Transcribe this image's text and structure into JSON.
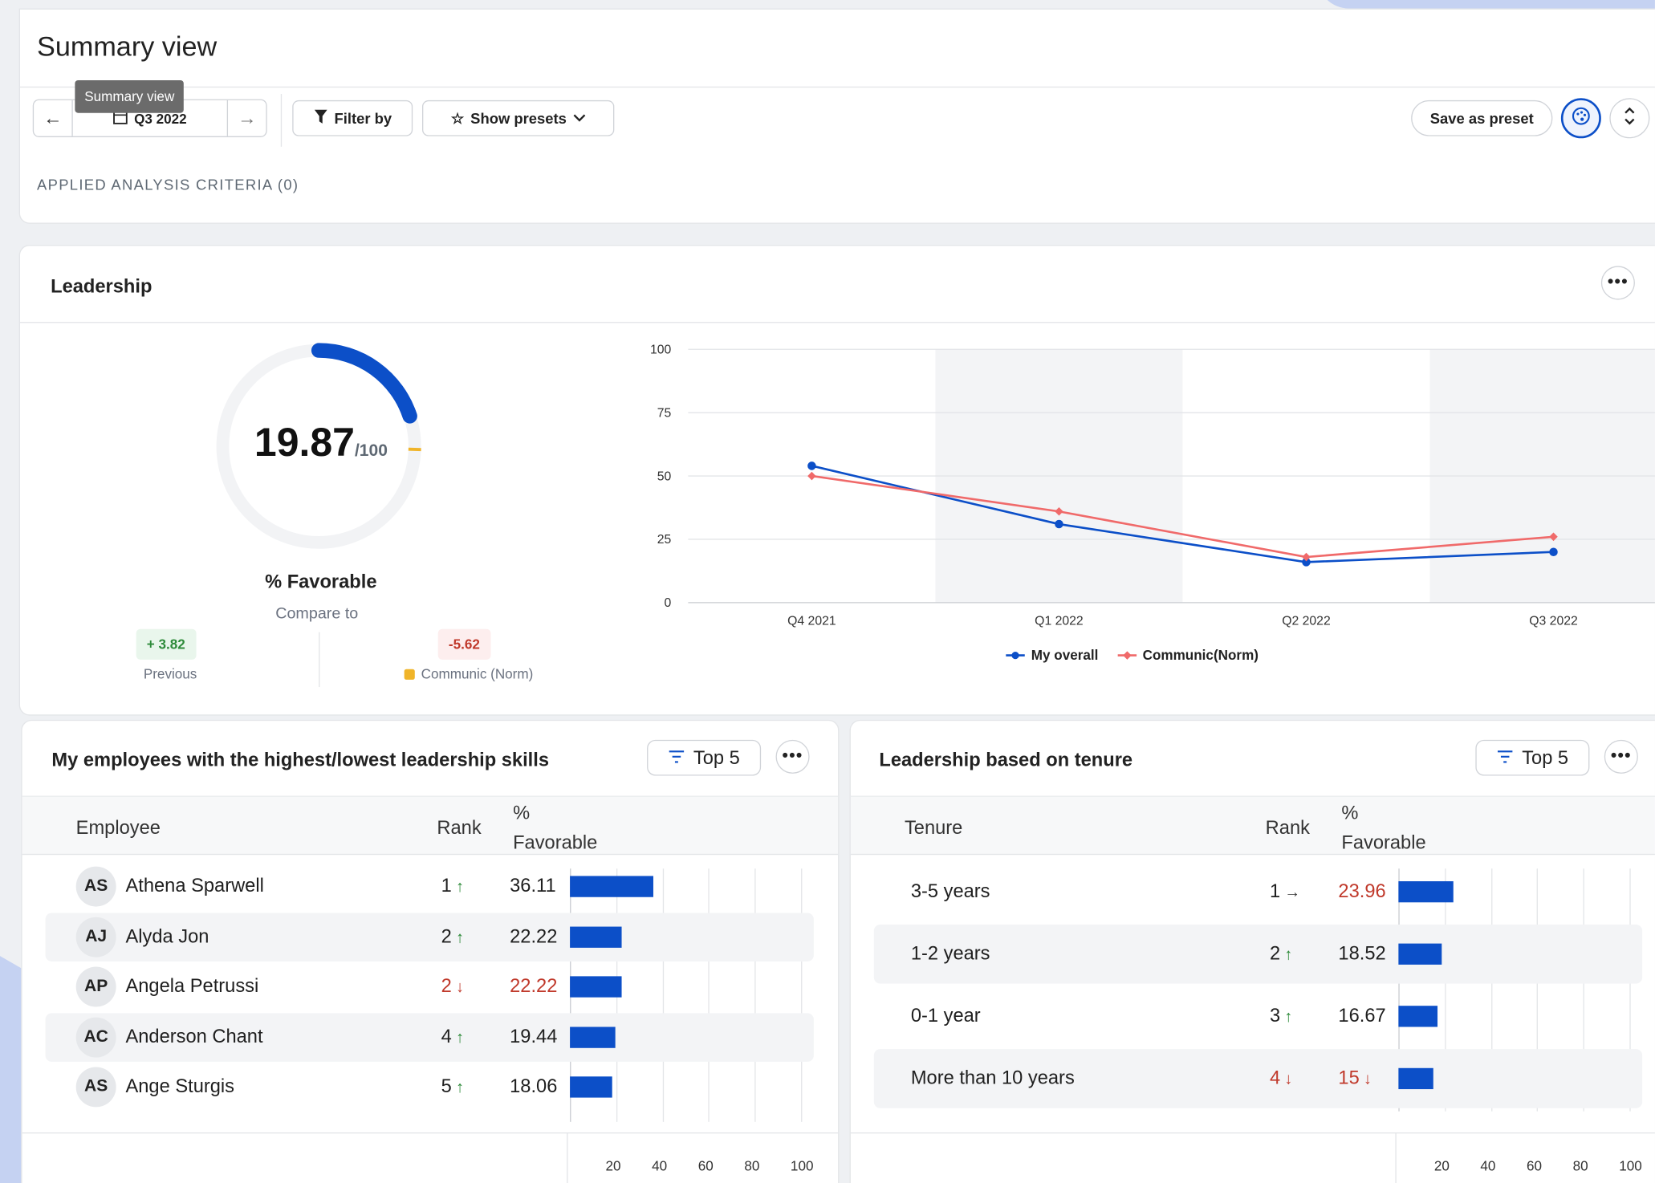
{
  "header": {
    "title": "Summary view",
    "tooltip": "Summary view",
    "date_nav": {
      "period": "Q3 2022"
    },
    "filter_label": "Filter by",
    "presets_label": "Show presets",
    "save_preset_label": "Save as preset",
    "criteria_label": "APPLIED ANALYSIS CRITERIA (0)"
  },
  "leadership": {
    "title": "Leadership",
    "score": "19.87",
    "score_denominator": "/100",
    "score_fraction": 0.1987,
    "norm_fraction": 0.2549,
    "favorable_label": "% Favorable",
    "compare_label": "Compare to",
    "previous_delta": "+ 3.82",
    "previous_label": "Previous",
    "norm_delta": "-5.62",
    "norm_label": "Communic (Norm)",
    "colors": {
      "accent": "#0c4fc8",
      "norm": "#f0b429",
      "positive": "#2e8b3a",
      "negative": "#c0392b"
    }
  },
  "chart_data": {
    "type": "line",
    "categories": [
      "Q4 2021",
      "Q1 2022",
      "Q2 2022",
      "Q3 2022"
    ],
    "ylim": [
      0,
      100
    ],
    "yticks": [
      0,
      25,
      50,
      75,
      100
    ],
    "legend_position": "bottom",
    "grid": true,
    "series": [
      {
        "name": "My overall",
        "values": [
          54,
          31,
          16,
          20
        ],
        "color": "#0c4fc8",
        "marker": "circle"
      },
      {
        "name": "Communic(Norm)",
        "values": [
          50,
          36,
          18,
          26
        ],
        "color": "#f06a6a",
        "marker": "diamond"
      }
    ]
  },
  "employees": {
    "title": "My employees with the highest/lowest leadership skills",
    "filter_label": "Top 5",
    "columns": {
      "name": "Employee",
      "rank": "Rank",
      "fav_line1": "%",
      "fav_line2": "Favorable"
    },
    "axis_ticks": [
      "20",
      "40",
      "60",
      "80",
      "100"
    ],
    "rows": [
      {
        "initials": "AS",
        "name": "Athena Sparwell",
        "rank": "1",
        "trend": "up",
        "value": "36.11",
        "value_num": 36.11,
        "value_red": false
      },
      {
        "initials": "AJ",
        "name": "Alyda Jon",
        "rank": "2",
        "trend": "up",
        "value": "22.22",
        "value_num": 22.22,
        "value_red": false
      },
      {
        "initials": "AP",
        "name": "Angela Petrussi",
        "rank": "2",
        "trend": "down",
        "value": "22.22",
        "value_num": 22.22,
        "value_red": true
      },
      {
        "initials": "AC",
        "name": "Anderson Chant",
        "rank": "4",
        "trend": "up",
        "value": "19.44",
        "value_num": 19.44,
        "value_red": false
      },
      {
        "initials": "AS",
        "name": "Ange Sturgis",
        "rank": "5",
        "trend": "up",
        "value": "18.06",
        "value_num": 18.06,
        "value_red": false
      }
    ]
  },
  "tenure": {
    "title": "Leadership based on tenure",
    "filter_label": "Top 5",
    "columns": {
      "name": "Tenure",
      "rank": "Rank",
      "fav_line1": "%",
      "fav_line2": "Favorable"
    },
    "axis_ticks": [
      "20",
      "40",
      "60",
      "80",
      "100"
    ],
    "rows": [
      {
        "name": "3-5 years",
        "rank": "1",
        "trend": "flat",
        "value": "23.96",
        "value_num": 23.96,
        "value_red": true,
        "value_trend": ""
      },
      {
        "name": "1-2 years",
        "rank": "2",
        "trend": "up",
        "value": "18.52",
        "value_num": 18.52,
        "value_red": false,
        "value_trend": ""
      },
      {
        "name": "0-1 year",
        "rank": "3",
        "trend": "up",
        "value": "16.67",
        "value_num": 16.67,
        "value_red": false,
        "value_trend": ""
      },
      {
        "name": "More than 10 years",
        "rank": "4",
        "trend": "down",
        "value": "15",
        "value_num": 15,
        "value_red": true,
        "value_trend": "down"
      }
    ]
  }
}
